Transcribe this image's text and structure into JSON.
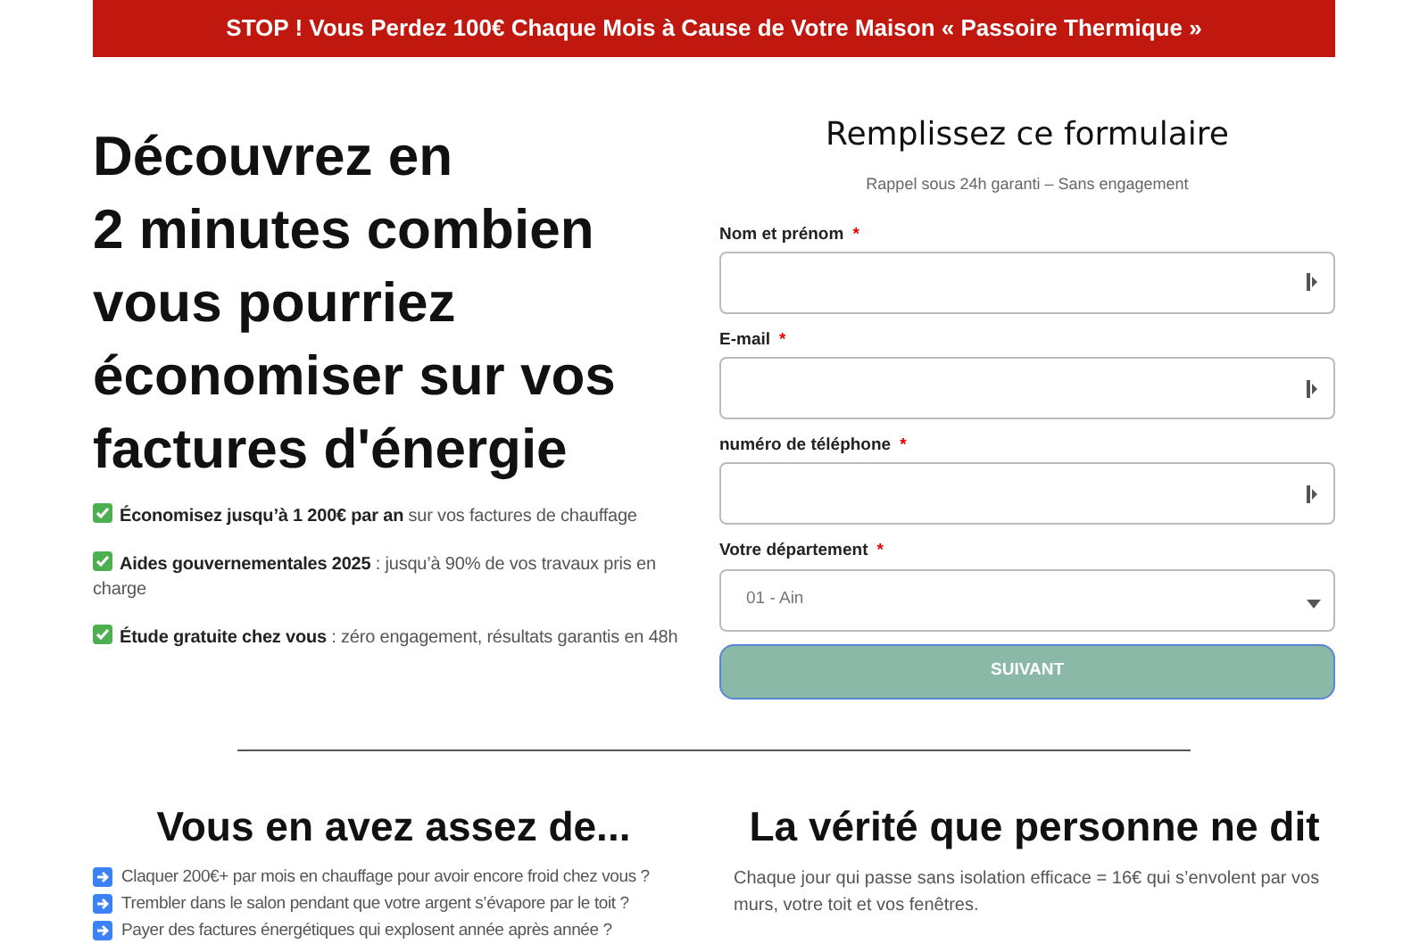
{
  "banner": {
    "text": "STOP ! Vous Perdez 100€ Chaque Mois à Cause de Votre Maison « Passoire Thermique »"
  },
  "hero": {
    "headline_lines": [
      "Découvrez en",
      "2 minutes combien",
      "vous pourriez",
      "économiser sur vos",
      "factures d'énergie"
    ],
    "benefits": [
      {
        "text": "**Économisez jusqu’à 1 200€ par an** sur vos factures de chauffage"
      },
      {
        "text": "**Aides gouvernementales 2025** : jusqu’à 90% de vos travaux pris en charge"
      },
      {
        "text": "**Étude gratuite chez vous** : zéro engagement, résultats garantis en 48h"
      }
    ]
  },
  "form": {
    "title": "Remplissez ce formulaire",
    "subtitle": "Rappel sous 24h garanti – Sans engagement",
    "fields": [
      {
        "kind": "text",
        "label": "Nom et prénom",
        "required_mark": "*"
      },
      {
        "kind": "text",
        "label": "E-mail",
        "required_mark": "*"
      },
      {
        "kind": "text",
        "label": "numéro de téléphone",
        "required_mark": "*"
      },
      {
        "kind": "select",
        "label": "Votre département",
        "required_mark": "*",
        "value": "01 - Ain"
      }
    ],
    "submit": {
      "label": "SUIVANT",
      "disabled": true
    }
  },
  "problems": {
    "title": "Vous en avez assez de...",
    "items": [
      "Claquer 200€+ par mois en chauffage pour avoir encore froid chez vous ?",
      "Trembler dans le salon pendant que votre argent s’évapore par le toit ?",
      "Payer des factures énergétiques qui explosent année après année ?"
    ]
  },
  "truth": {
    "title": "La vérité que personne ne dit",
    "paragraphs": [
      "Chaque jour qui passe sans isolation efficace = 16€ qui s’envolent par vos murs, votre toit et vos fenêtres."
    ]
  }
}
